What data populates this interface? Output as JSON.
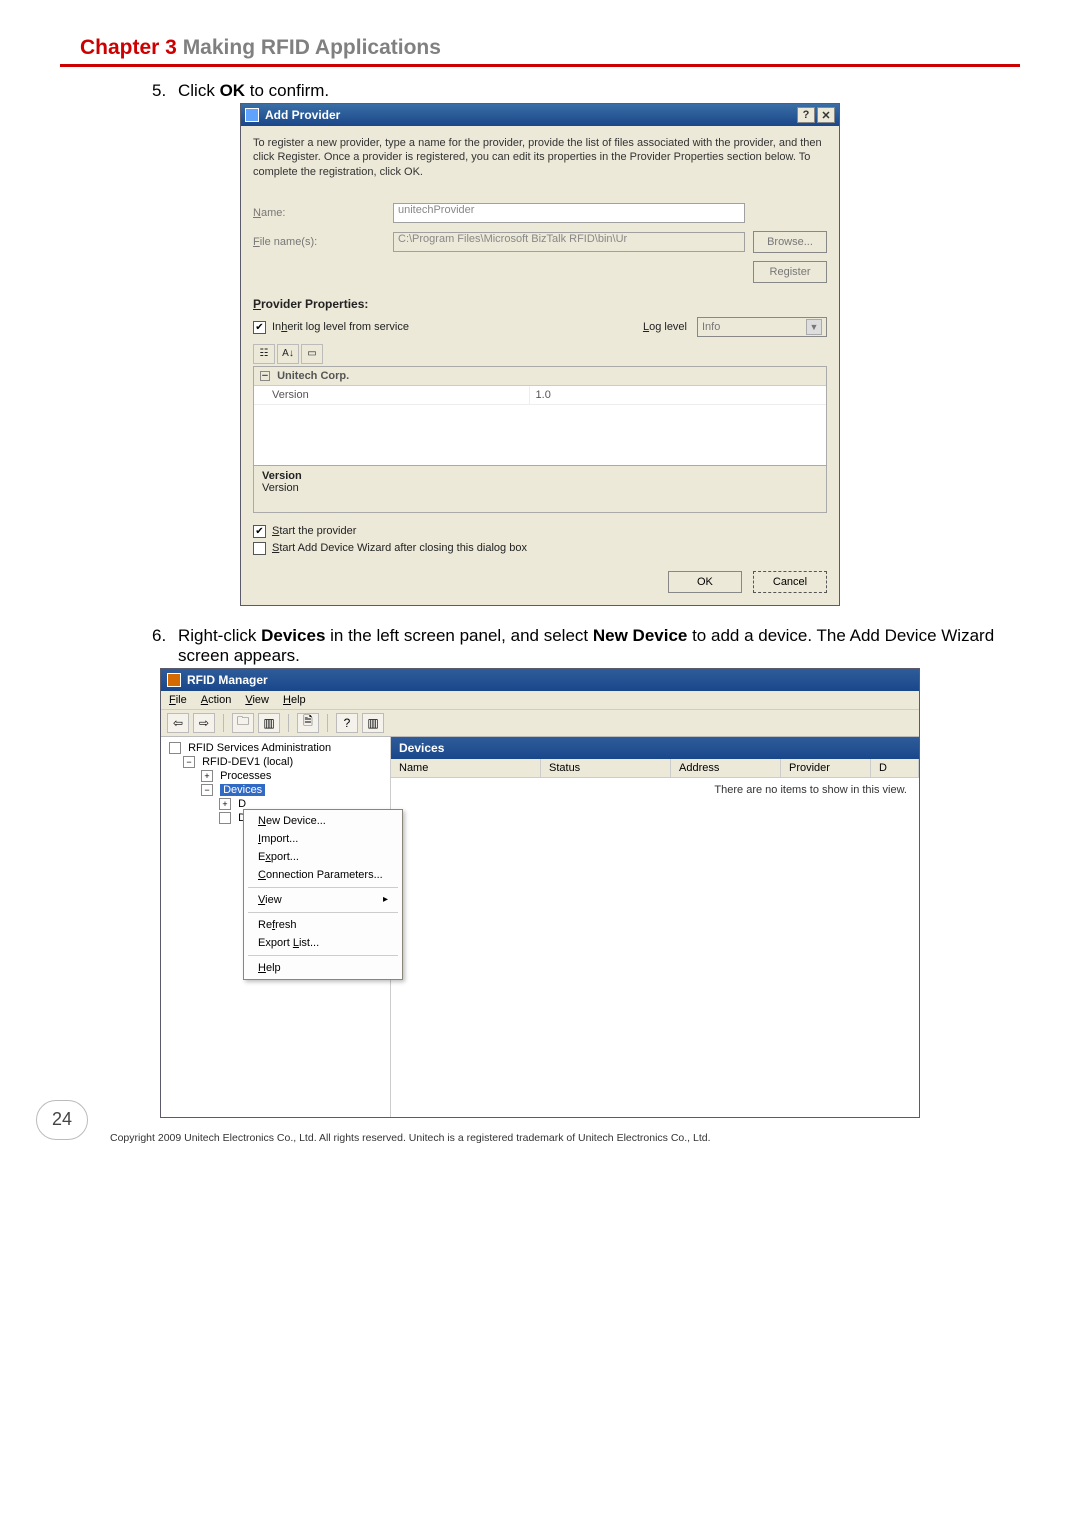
{
  "chapter": {
    "red": "Chapter 3",
    "gray": "  Making RFID Applications"
  },
  "step5": {
    "num": "5.",
    "prefix": "Click ",
    "bold": "OK",
    "suffix": " to confirm."
  },
  "addProvider": {
    "title": "Add Provider",
    "intro": "To register a new provider, type a name for the provider, provide the list of files associated with the provider, and then click Register. Once a provider is registered, you can edit its properties in the Provider Properties section below. To complete the registration, click OK.",
    "nameLabelPrefix": "N",
    "nameLabelRest": "ame:",
    "nameValue": "unitechProvider",
    "fileLabelPrefix": "F",
    "fileLabelRest": "ile name(s):",
    "fileValue": "C:\\Program Files\\Microsoft BizTalk RFID\\bin\\Ur",
    "browseBtn": "Browse...",
    "registerBtn": "Register",
    "propsHeader": "Provider Properties:",
    "inheritPrefix": "In",
    "inheritU": "h",
    "inheritRest": "erit log level from service",
    "logLabelPrefix": "L",
    "logLabelRest": "og level",
    "logValue": "Info",
    "gridHeader": "Unitech Corp.",
    "gridRowKey": "Version",
    "gridRowVal": "1.0",
    "descTitle": "Version",
    "descBody": "Version",
    "startProvPrefix": "S",
    "startProvRest": "tart the provider",
    "startWizPrefix": "S",
    "startWizRest": "tart Add Device Wizard after closing this dialog box",
    "okBtn": "OK",
    "cancelBtn": "Cancel"
  },
  "step6": {
    "num": "6.",
    "t1": "Right-click ",
    "b1": "Devices",
    "t2": " in the left screen panel, and select ",
    "b2": "New Device",
    "t3": " to add a device. The Add Device Wizard screen appears."
  },
  "mgr": {
    "title": "RFID Manager",
    "menu": {
      "file": "File",
      "action": "Action",
      "view": "View",
      "help": "Help"
    },
    "tree": {
      "root": "RFID Services Administration",
      "host": "RFID-DEV1 (local)",
      "processes": "Processes",
      "devices": "Devices",
      "d1": "D",
      "d2": "D"
    },
    "ctx": {
      "newDevice": "New Device...",
      "import": "Import...",
      "export": "Export...",
      "connParams": "Connection Parameters...",
      "view": "View",
      "refresh": "Refresh",
      "exportList": "Export List...",
      "help": "Help"
    },
    "list": {
      "header": "Devices",
      "colName": "Name",
      "colStatus": "Status",
      "colAddress": "Address",
      "colProvider": "Provider",
      "colD": "D",
      "empty": "There are no items to show in this view."
    }
  },
  "pageNumber": "24",
  "copyright": "Copyright 2009 Unitech Electronics Co., Ltd. All rights reserved. Unitech is a registered trademark of Unitech Electronics Co., Ltd."
}
